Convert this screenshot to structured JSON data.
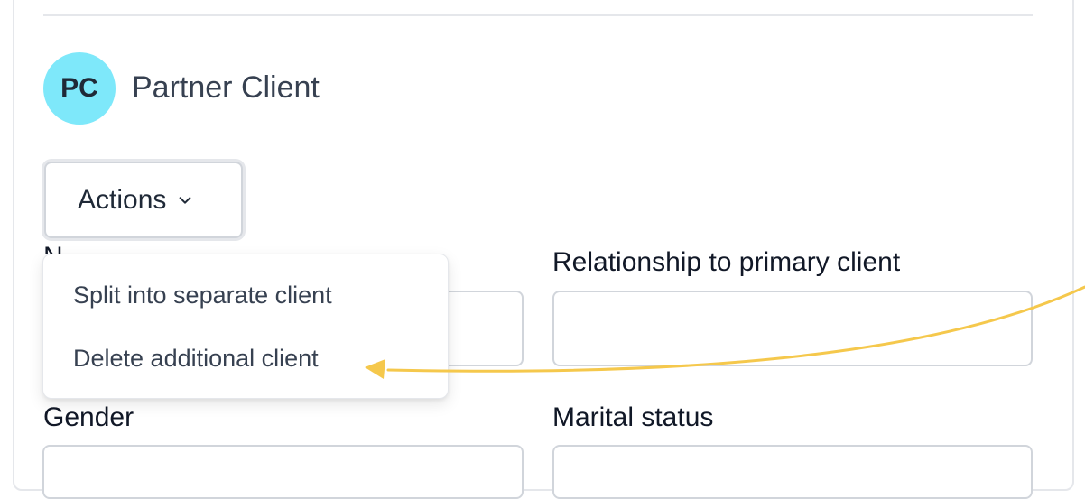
{
  "client": {
    "initials": "PC",
    "name": "Partner Client"
  },
  "actions": {
    "label": "Actions"
  },
  "menu": {
    "items": [
      {
        "label": "Split into separate client"
      },
      {
        "label": "Delete additional client"
      }
    ]
  },
  "fields": {
    "name_label_partial": "N",
    "relationship_label": "Relationship to primary client",
    "relationship_value": "",
    "gender_label": "Gender",
    "marital_label": "Marital status"
  },
  "colors": {
    "avatar_bg": "#7ee8fa",
    "arrow": "#f5c84c"
  }
}
